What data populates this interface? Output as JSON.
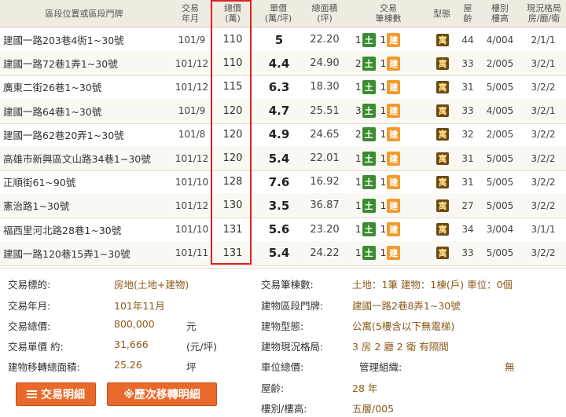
{
  "header": {
    "addr": "區段位置或區段門牌",
    "date": "交易\n年月",
    "total": "總價\n(萬)",
    "unit": "單價\n(萬/坪)",
    "area": "總面積\n(坪)",
    "count": "交易\n筆棟數",
    "type": "型態",
    "age": "屋\n齡",
    "floor": "樓別\n樓高",
    "rooms": "現況格局\n房/廳/衛"
  },
  "rows": [
    {
      "addr": "建國一路203巷4衖1~30號",
      "date": "101/9",
      "total": "110",
      "unit": "5",
      "area": "22.20",
      "land": "1",
      "land_label": "土",
      "bld": "1",
      "bld_label": "建",
      "type": "寓",
      "age": "44",
      "floor": "4/004",
      "rooms": "2/1/1"
    },
    {
      "addr": "建國一路72巷1弄1~30號",
      "date": "101/12",
      "total": "110",
      "unit": "4.4",
      "area": "24.90",
      "land": "2",
      "land_label": "土",
      "bld": "1",
      "bld_label": "建",
      "type": "寓",
      "age": "33",
      "floor": "2/005",
      "rooms": "3/2/1"
    },
    {
      "addr": "廣東二街26巷1~30號",
      "date": "101/12",
      "total": "115",
      "unit": "6.3",
      "area": "18.30",
      "land": "1",
      "land_label": "土",
      "bld": "1",
      "bld_label": "建",
      "type": "寓",
      "age": "31",
      "floor": "5/005",
      "rooms": "3/2/2"
    },
    {
      "addr": "建國一路64巷1~30號",
      "date": "101/9",
      "total": "120",
      "unit": "4.7",
      "area": "25.51",
      "land": "3",
      "land_label": "土",
      "bld": "1",
      "bld_label": "建",
      "type": "寓",
      "age": "33",
      "floor": "4/005",
      "rooms": "3/2/1"
    },
    {
      "addr": "建國一路62巷20弄1~30號",
      "date": "101/8",
      "total": "120",
      "unit": "4.9",
      "area": "24.65",
      "land": "2",
      "land_label": "土",
      "bld": "1",
      "bld_label": "建",
      "type": "寓",
      "age": "32",
      "floor": "2/005",
      "rooms": "3/2/2"
    },
    {
      "addr": "高雄市新興區文山路34巷1~30號",
      "date": "101/12",
      "total": "120",
      "unit": "5.4",
      "area": "22.01",
      "land": "1",
      "land_label": "土",
      "bld": "1",
      "bld_label": "建",
      "type": "寓",
      "age": "31",
      "floor": "5/005",
      "rooms": "3/2/2"
    },
    {
      "addr": "正順街61~90號",
      "date": "101/10",
      "total": "128",
      "unit": "7.6",
      "area": "16.92",
      "land": "1",
      "land_label": "土",
      "bld": "1",
      "bld_label": "建",
      "type": "寓",
      "age": "31",
      "floor": "5/005",
      "rooms": "3/2/2"
    },
    {
      "addr": "憲治路1~30號",
      "date": "101/12",
      "total": "130",
      "unit": "3.5",
      "area": "36.87",
      "land": "1",
      "land_label": "土",
      "bld": "1",
      "bld_label": "建",
      "type": "寓",
      "age": "27",
      "floor": "5/005",
      "rooms": "3/2/2"
    },
    {
      "addr": "福西里河北路28巷1~30號",
      "date": "101/10",
      "total": "131",
      "unit": "5.6",
      "area": "23.20",
      "land": "1",
      "land_label": "土",
      "bld": "1",
      "bld_label": "建",
      "type": "寓",
      "age": "34",
      "floor": "3/004",
      "rooms": "3/1/1"
    },
    {
      "addr": "建國一路120巷15弄1~30號",
      "date": "101/11",
      "total": "131",
      "unit": "5.4",
      "area": "24.22",
      "land": "1",
      "land_label": "土",
      "bld": "1",
      "bld_label": "建",
      "type": "寓",
      "age": "33",
      "floor": "5/005",
      "rooms": "3/2/2"
    }
  ],
  "detail": {
    "target_label": "交易標的:",
    "target_value": "房地(土地+建物)",
    "ym_label": "交易年月:",
    "ym_value": "101年11月",
    "total_label": "交易總價:",
    "total_value": "800,000",
    "total_unit": "元",
    "unit_label": "交易單價 約:",
    "unit_value": "31,666",
    "unit_unit": "(元/坪)",
    "area_label": "建物移轉總面積:",
    "area_value": "25.26",
    "area_unit": "坪",
    "count_label": "交易筆棟數:",
    "count_value": "土地：1筆 建物：1棟(戶) 車位：0個",
    "addr_label": "建物區段門牌:",
    "addr_value": "建國一路2巷8弄1~30號",
    "btype_label": "建物型態:",
    "btype_value": "公寓(5樓含以下無電梯)",
    "layout_label": "建物現況格局:",
    "layout_value": "3 房 2 廳 2 衛 有隔間",
    "parking_label": "車位總價:",
    "mgmt_label": "管理組織:",
    "mgmt_value": "無",
    "age_label": "屋齡:",
    "age_value": "28  年",
    "floor_label": "樓別/樓高:",
    "floor_value": "五層/005"
  },
  "buttons": {
    "detail_label": "交易明細",
    "history_label": "※歷次移轉明細"
  },
  "colors": {
    "accent": "#e8692a",
    "highlight_box": "#d22222",
    "land_badge": "#3a8d2f",
    "building_badge": "#f39a2b"
  }
}
